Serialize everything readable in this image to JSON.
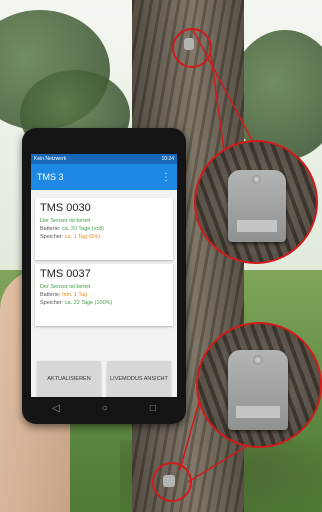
{
  "phone": {
    "status_left": "Kein Netzwerk",
    "status_right": "10:24",
    "app_title": "TMS 3",
    "menu_icon": "more-vert-icon",
    "devices": [
      {
        "name": "TMS 0030",
        "status": "Der Sensor ist bereit",
        "battery_label": "Batterie:",
        "battery_value": "ca. 20 Tage (voll)",
        "storage_label": "Speicher:",
        "storage_value": "ca. 1 Tag (6%)"
      },
      {
        "name": "TMS 0037",
        "status": "Der Sensor ist bereit",
        "battery_label": "Batterie:",
        "battery_value": "min. 1 Tag",
        "storage_label": "Speicher:",
        "storage_value": "ca. 22 Tage (100%)"
      }
    ],
    "buttons": {
      "refresh": "AKTUALISIEREN",
      "live": "LIVEMODUS ANSICHT"
    },
    "nav_icons": [
      "back-icon",
      "home-icon",
      "recents-icon"
    ]
  },
  "colors": {
    "appbar": "#1e88e5",
    "status_ok": "#43a047",
    "warning": "#ef8a1e",
    "callout": "#d01b1b"
  }
}
